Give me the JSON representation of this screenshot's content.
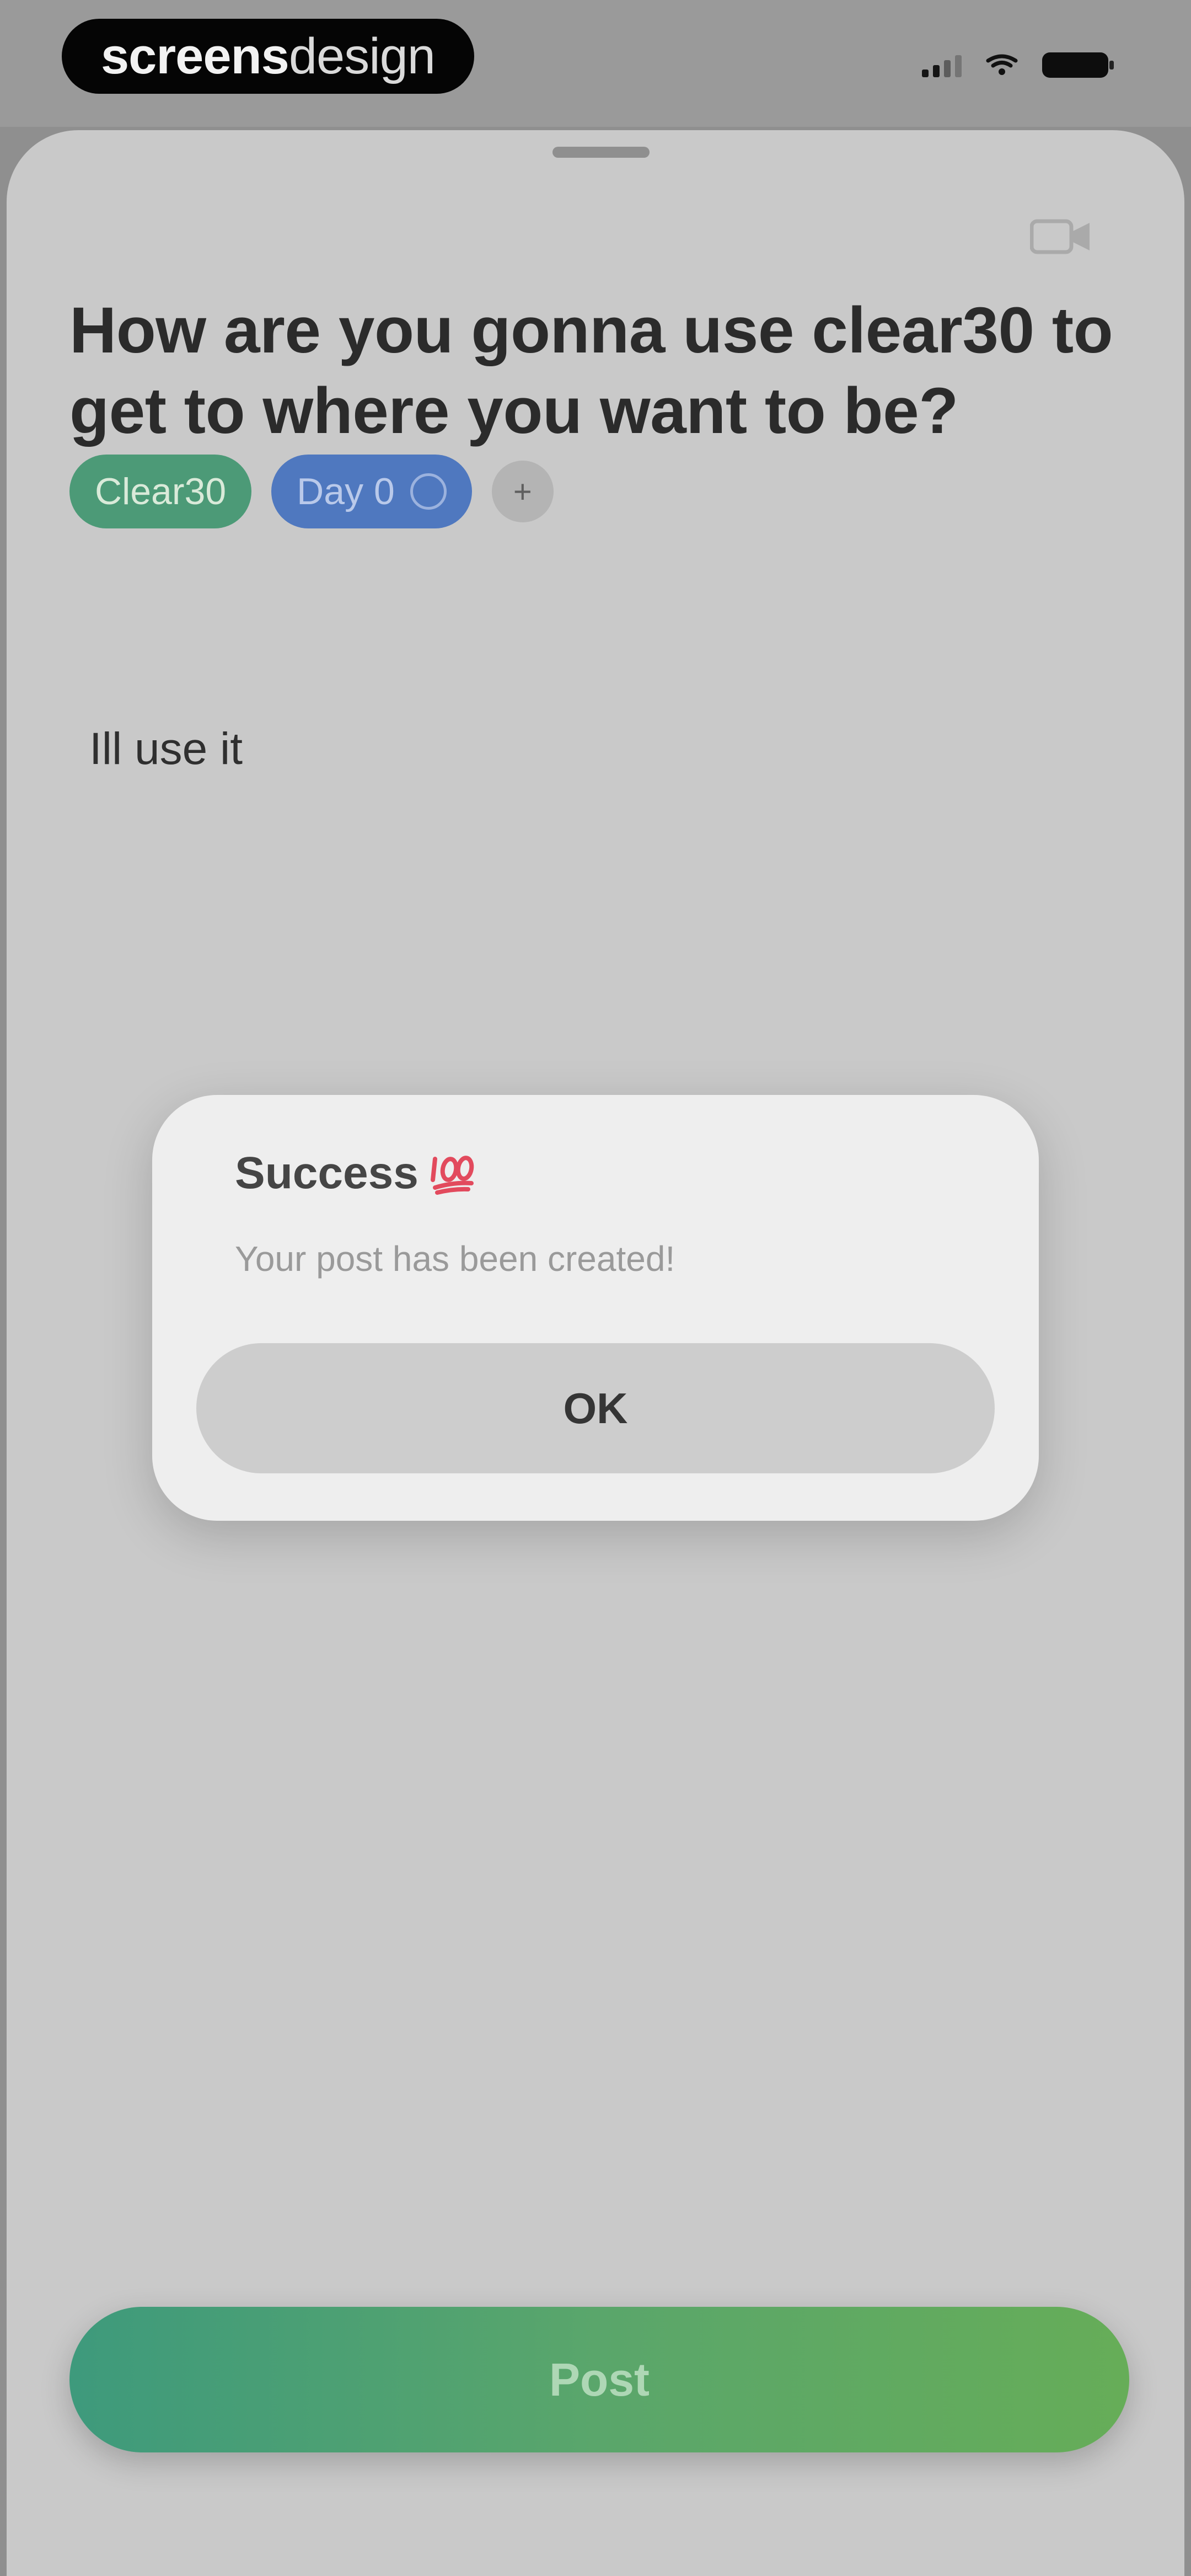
{
  "status_bar": {
    "brand_bold": "screens",
    "brand_light": "design",
    "signal_icon": "signal-icon",
    "wifi_icon": "wifi-icon",
    "battery_icon": "battery-icon"
  },
  "sheet": {
    "title": "How are you gonna use clear30 to get to where you want to be?",
    "corner_icon": "video-icon",
    "tags": [
      {
        "label": "Clear30",
        "color": "#4c9a77"
      },
      {
        "label": "Day 0",
        "color": "#4f78bf",
        "icon": "info-icon"
      }
    ],
    "add_tag_label": "+",
    "body": "Ill use it",
    "post_label": "Post",
    "post_colors": [
      "#3e9a7c",
      "#66ad58"
    ]
  },
  "alert": {
    "title": "Success",
    "emoji_icon": "hundred-points-icon",
    "message": "Your post has been created!",
    "button_label": "OK"
  }
}
